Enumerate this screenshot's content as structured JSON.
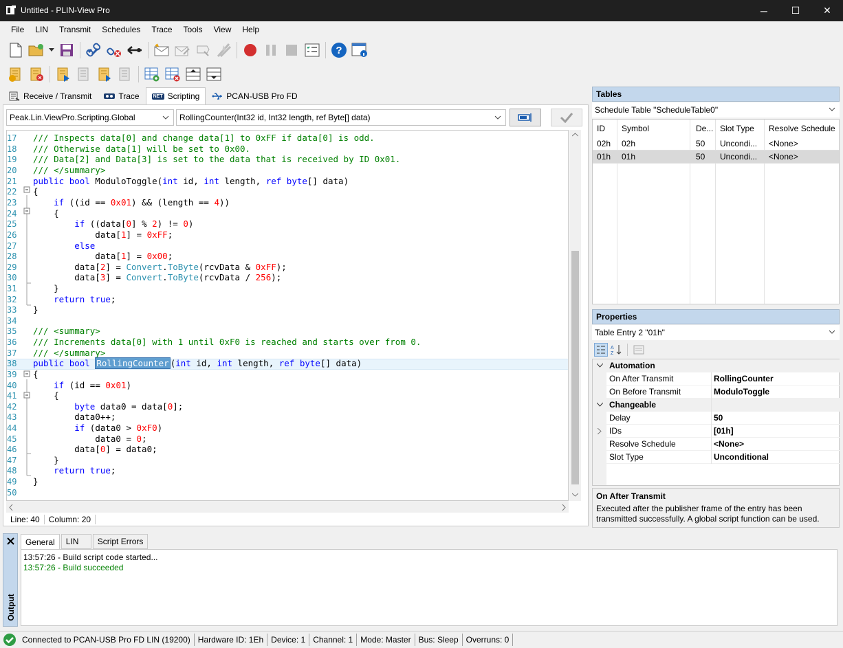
{
  "window": {
    "title": "Untitled - PLIN-View Pro",
    "minimize": "─",
    "maximize": "☐",
    "close": "✕"
  },
  "menu": [
    "File",
    "LIN",
    "Transmit",
    "Schedules",
    "Trace",
    "Tools",
    "View",
    "Help"
  ],
  "toolbar1_icons": [
    "new-file-icon",
    "open-folder-icon",
    "dropdown-arrow-icon",
    "save-icon",
    "connect-icon",
    "disconnect-icon",
    "lin-hardware-icon",
    "new-message-icon",
    "edit-message-icon",
    "delete-message-icon",
    "send-message-icon",
    "record-icon",
    "pause-icon",
    "stop-icon",
    "trace-settings-icon",
    "help-icon",
    "about-icon"
  ],
  "toolbar2_icons": [
    "schedule-new-icon",
    "schedule-delete-icon",
    "schedule-start-icon",
    "schedule-suspend-icon",
    "schedule-resume-icon",
    "schedule-stop-icon",
    "table-add-row-icon",
    "table-delete-row-icon",
    "table-move-up-icon",
    "table-move-down-icon"
  ],
  "tabs": [
    {
      "label": "Receive / Transmit",
      "icon": "receive-transmit-icon"
    },
    {
      "label": "Trace",
      "icon": "trace-icon"
    },
    {
      "label": "Scripting",
      "icon": "net-icon",
      "badge": "NET"
    },
    {
      "label": "PCAN-USB Pro FD",
      "icon": "usb-icon"
    }
  ],
  "editor": {
    "namespace_select": "Peak.Lin.ViewPro.Scripting.Global",
    "method_select": "RollingCounter(Int32 id, Int32 length, ref Byte[] data)",
    "line_numbers": [
      "17",
      "18",
      "19",
      "20",
      "21",
      "22",
      "23",
      "24",
      "25",
      "26",
      "27",
      "28",
      "29",
      "30",
      "31",
      "32",
      "33",
      "34",
      "35",
      "36",
      "37",
      "38",
      "39",
      "40",
      "41",
      "42",
      "43",
      "44",
      "45",
      "46",
      "47",
      "48",
      "49",
      "50"
    ],
    "status_line": "Line: 40",
    "status_column": "Column: 20"
  },
  "tables_panel": {
    "title": "Tables",
    "selector": "Schedule Table \"ScheduleTable0\"",
    "columns": [
      "ID",
      "Symbol",
      "De...",
      "Slot Type",
      "Resolve Schedule"
    ],
    "rows": [
      [
        "02h",
        "02h",
        "50",
        "Uncondi...",
        "<None>"
      ],
      [
        "01h",
        "01h",
        "50",
        "Uncondi...",
        "<None>"
      ]
    ]
  },
  "properties_panel": {
    "title": "Properties",
    "selector": "Table Entry 2 \"01h\"",
    "categories": [
      {
        "name": "Automation",
        "items": [
          {
            "name": "On After Transmit",
            "value": "RollingCounter"
          },
          {
            "name": "On Before Transmit",
            "value": "ModuloToggle"
          }
        ]
      },
      {
        "name": "Changeable",
        "items": [
          {
            "name": "Delay",
            "value": "50"
          },
          {
            "name": "IDs",
            "value": "[01h]"
          },
          {
            "name": "Resolve Schedule",
            "value": "<None>"
          },
          {
            "name": "Slot Type",
            "value": "Unconditional"
          }
        ]
      }
    ],
    "desc_title": "On After Transmit",
    "desc_text": "Executed after the publisher frame of the entry has been transmitted successfully. A global script function can be used."
  },
  "output": {
    "side_label": "Output",
    "tabs": [
      "General",
      "LIN",
      "Script Errors"
    ],
    "lines": [
      {
        "text": "13:57:26 - Build script code started...",
        "color": "#000000"
      },
      {
        "text": "13:57:26 - Build succeeded",
        "color": "#008000"
      }
    ]
  },
  "statusbar": [
    "Connected to PCAN-USB Pro FD LIN (19200)",
    "Hardware ID: 1Eh",
    "Device: 1",
    "Channel: 1",
    "Mode: Master",
    "Bus: Sleep",
    "Overruns: 0"
  ]
}
